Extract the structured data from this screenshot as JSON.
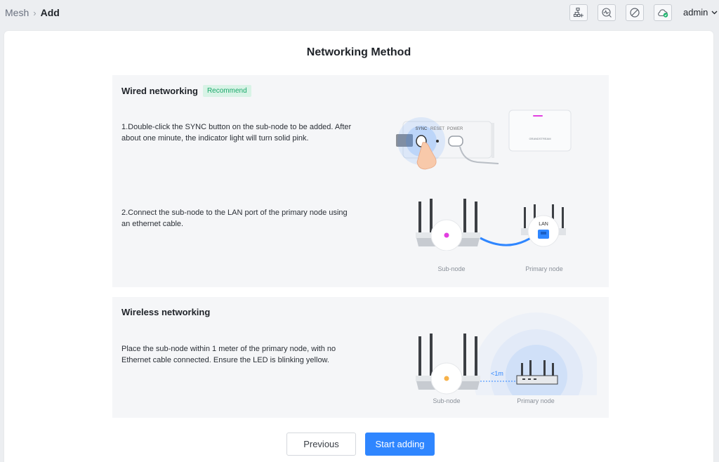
{
  "breadcrumb": {
    "parent": "Mesh",
    "current": "Add"
  },
  "user": {
    "name": "admin"
  },
  "toolbar": {
    "icons": [
      "topology-add-icon",
      "diagnostics-icon",
      "disable-icon",
      "cloud-check-icon"
    ]
  },
  "page": {
    "title": "Networking Method"
  },
  "wired": {
    "title": "Wired networking",
    "badge": "Recommend",
    "step1": "1.Double-click the SYNC button on the sub-node to be added. After about one minute, the indicator light will turn solid pink.",
    "step2": "2.Connect the sub-node to the LAN port of the primary node using an ethernet cable.",
    "sync_labels": {
      "sync": "SYNC",
      "reset": "RESET",
      "power": "POWER"
    },
    "device_brand": "GRANDSTREAM",
    "lan_label": "LAN",
    "sub_node_caption": "Sub-node",
    "primary_node_caption": "Primary node"
  },
  "wireless": {
    "title": "Wireless networking",
    "step": "Place the sub-node within 1 meter of the primary node, with no Ethernet cable connected. Ensure the LED is blinking yellow.",
    "distance_label": "<1m",
    "sub_node_caption": "Sub-node",
    "primary_node_caption": "Primary node"
  },
  "buttons": {
    "previous": "Previous",
    "start": "Start adding"
  },
  "colors": {
    "accent": "#2f86ff",
    "badge_bg": "#d8f3e6",
    "badge_text": "#1aa86a",
    "led_pink": "#e23ee0",
    "led_yellow": "#f7b24a"
  }
}
